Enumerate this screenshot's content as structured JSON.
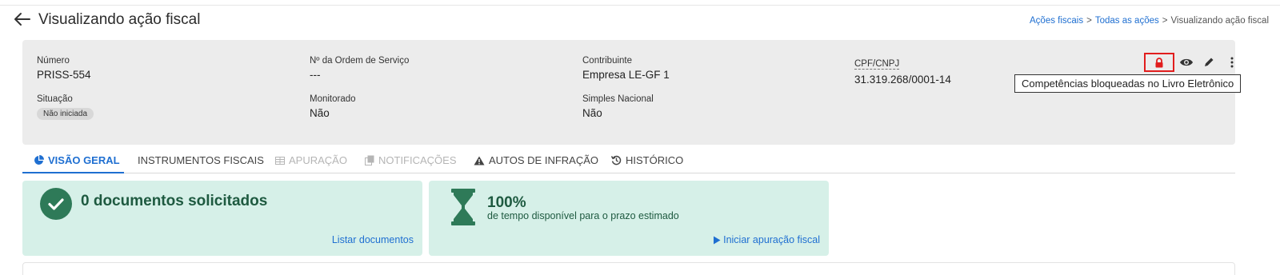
{
  "header": {
    "title": "Visualizando ação fiscal",
    "breadcrumb": [
      "Ações fiscais",
      "Todas as ações",
      "Visualizando ação fiscal"
    ],
    "breadcrumb_sep": ">"
  },
  "info": {
    "numero": {
      "label": "Número",
      "value": "PRISS-554"
    },
    "ordem": {
      "label": "Nº da Ordem de Serviço",
      "value": "---"
    },
    "contribuinte": {
      "label": "Contribuinte",
      "value": "Empresa LE-GF 1"
    },
    "cpf": {
      "label": "CPF/CNPJ",
      "value": "31.319.268/0001-14"
    },
    "situacao": {
      "label": "Situação",
      "value": "Não iniciada"
    },
    "monitorado": {
      "label": "Monitorado",
      "value": "Não"
    },
    "simples": {
      "label": "Simples Nacional",
      "value": "Não"
    }
  },
  "tooltip": "Competências bloqueadas no Livro Eletrônico",
  "tabs": [
    {
      "label": "VISÃO GERAL",
      "icon": "pie-chart-icon",
      "state": "active"
    },
    {
      "label": "INSTRUMENTOS FISCAIS",
      "icon": "",
      "state": "normal"
    },
    {
      "label": "APURAÇÃO",
      "icon": "table-icon",
      "state": "disabled"
    },
    {
      "label": "NOTIFICAÇÕES",
      "icon": "copy-icon",
      "state": "disabled"
    },
    {
      "label": "AUTOS DE INFRAÇÃO",
      "icon": "warning-icon",
      "state": "normal"
    },
    {
      "label": "HISTÓRICO",
      "icon": "history-icon",
      "state": "normal"
    }
  ],
  "cards": {
    "documents": {
      "title": "0 documentos solicitados",
      "link": "Listar documentos",
      "icon": "check-circle-icon"
    },
    "time": {
      "percent": "100%",
      "subtitle": "de tempo disponível para o prazo estimado",
      "link": "Iniciar apuração fiscal",
      "icon": "hourglass-icon"
    }
  },
  "colors": {
    "accent": "#1f6fd1",
    "card_bg": "#d6f0e8",
    "card_text": "#1e5a40",
    "lock_red": "#e11d1d"
  }
}
